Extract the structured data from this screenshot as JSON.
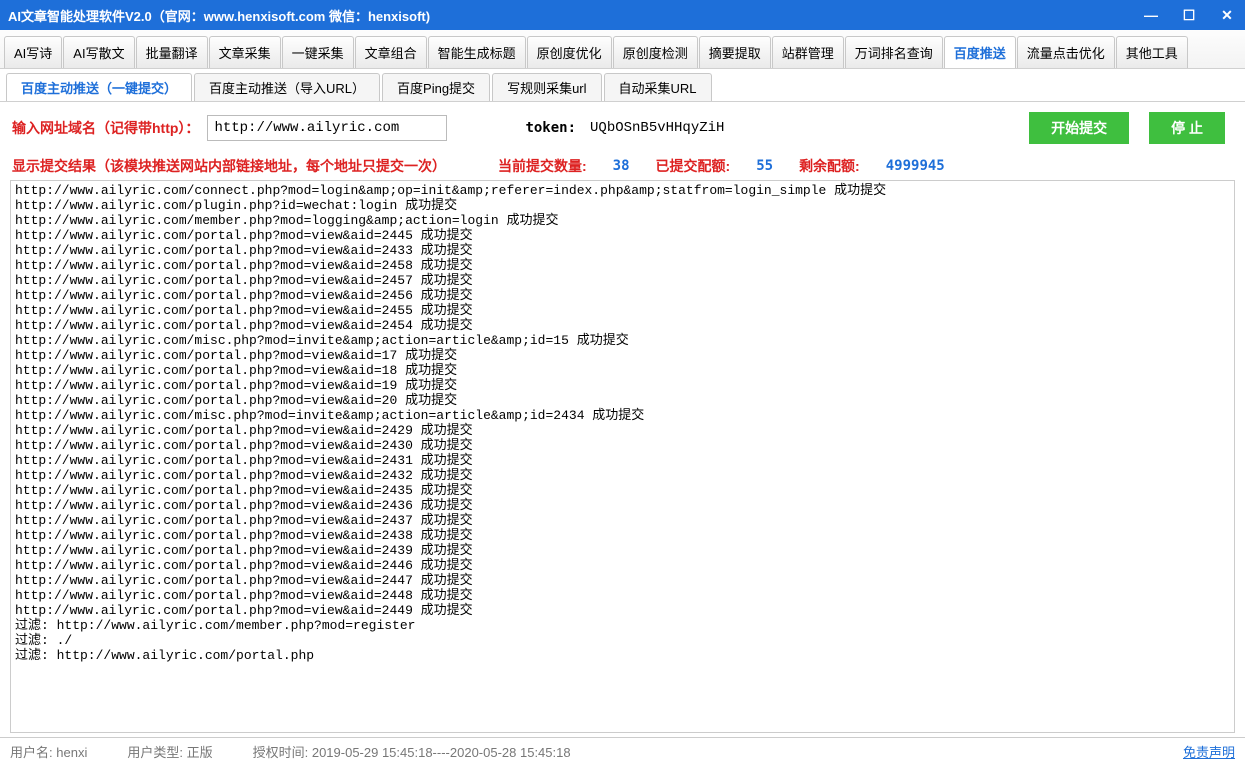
{
  "window": {
    "title": "AI文章智能处理软件V2.0（官网：www.henxisoft.com  微信：henxisoft)"
  },
  "mainTabs": [
    "AI写诗",
    "AI写散文",
    "批量翻译",
    "文章采集",
    "一键采集",
    "文章组合",
    "智能生成标题",
    "原创度优化",
    "原创度检测",
    "摘要提取",
    "站群管理",
    "万词排名查询",
    "百度推送",
    "流量点击优化",
    "其他工具"
  ],
  "mainTabActive": 12,
  "subTabs": [
    "百度主动推送（一键提交）",
    "百度主动推送（导入URL）",
    "百度Ping提交",
    "写规则采集url",
    "自动采集URL"
  ],
  "subTabActive": 0,
  "form": {
    "domainLabel": "输入网址域名（记得带http）：",
    "domainValue": "http://www.ailyric.com",
    "tokenLabel": "token:",
    "tokenValue": "UQbOSnB5vHHqyZiH",
    "startBtn": "开始提交",
    "stopBtn": "停 止"
  },
  "resultHeader": {
    "title": "显示提交结果（该模块推送网站内部链接地址，每个地址只提交一次）",
    "currentLabel": "当前提交数量:",
    "currentValue": "38",
    "submittedLabel": "已提交配额:",
    "submittedValue": "55",
    "remainLabel": "剩余配额:",
    "remainValue": "4999945"
  },
  "log": [
    "http://www.ailyric.com/connect.php?mod=login&amp;op=init&amp;referer=index.php&amp;statfrom=login_simple    成功提交",
    "http://www.ailyric.com/plugin.php?id=wechat:login    成功提交",
    "http://www.ailyric.com/member.php?mod=logging&amp;action=login    成功提交",
    "http://www.ailyric.com/portal.php?mod=view&aid=2445    成功提交",
    "http://www.ailyric.com/portal.php?mod=view&aid=2433    成功提交",
    "http://www.ailyric.com/portal.php?mod=view&aid=2458    成功提交",
    "http://www.ailyric.com/portal.php?mod=view&aid=2457    成功提交",
    "http://www.ailyric.com/portal.php?mod=view&aid=2456    成功提交",
    "http://www.ailyric.com/portal.php?mod=view&aid=2455    成功提交",
    "http://www.ailyric.com/portal.php?mod=view&aid=2454    成功提交",
    "http://www.ailyric.com/misc.php?mod=invite&amp;action=article&amp;id=15    成功提交",
    "http://www.ailyric.com/portal.php?mod=view&aid=17    成功提交",
    "http://www.ailyric.com/portal.php?mod=view&aid=18    成功提交",
    "http://www.ailyric.com/portal.php?mod=view&aid=19    成功提交",
    "http://www.ailyric.com/portal.php?mod=view&aid=20    成功提交",
    "http://www.ailyric.com/misc.php?mod=invite&amp;action=article&amp;id=2434    成功提交",
    "http://www.ailyric.com/portal.php?mod=view&aid=2429    成功提交",
    "http://www.ailyric.com/portal.php?mod=view&aid=2430    成功提交",
    "http://www.ailyric.com/portal.php?mod=view&aid=2431    成功提交",
    "http://www.ailyric.com/portal.php?mod=view&aid=2432    成功提交",
    "http://www.ailyric.com/portal.php?mod=view&aid=2435    成功提交",
    "http://www.ailyric.com/portal.php?mod=view&aid=2436    成功提交",
    "http://www.ailyric.com/portal.php?mod=view&aid=2437    成功提交",
    "http://www.ailyric.com/portal.php?mod=view&aid=2438    成功提交",
    "http://www.ailyric.com/portal.php?mod=view&aid=2439    成功提交",
    "http://www.ailyric.com/portal.php?mod=view&aid=2446    成功提交",
    "http://www.ailyric.com/portal.php?mod=view&aid=2447    成功提交",
    "http://www.ailyric.com/portal.php?mod=view&aid=2448    成功提交",
    "http://www.ailyric.com/portal.php?mod=view&aid=2449    成功提交",
    "",
    "过滤: http://www.ailyric.com/member.php?mod=register",
    "过滤: ./",
    "过滤: http://www.ailyric.com/portal.php"
  ],
  "statusBar": {
    "userLabel": "用户名:",
    "userValue": "henxi",
    "typeLabel": "用户类型:",
    "typeValue": "正版",
    "authLabel": "授权时间:",
    "authValue": "2019-05-29 15:45:18----2020-05-28 15:45:18",
    "legal": "免责声明"
  }
}
